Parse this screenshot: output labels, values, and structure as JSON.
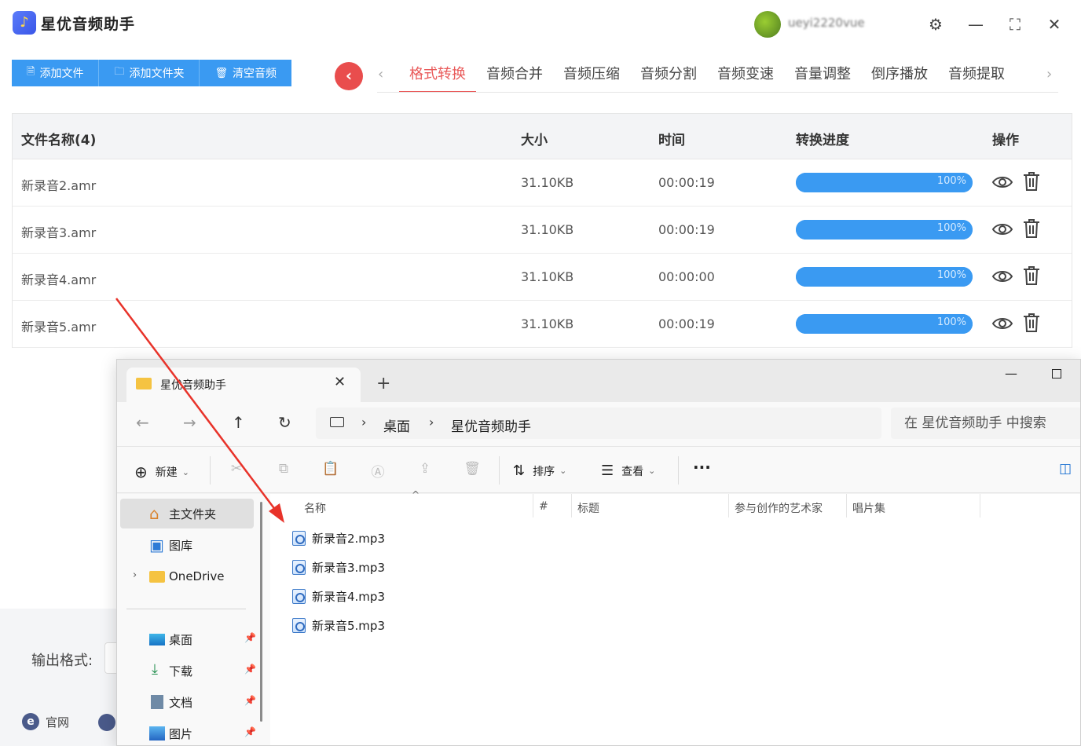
{
  "app": {
    "title": "星优音频助手",
    "logo_glyph": "♪",
    "username": "ueyi2220vue",
    "window_controls": {
      "settings": "⚙",
      "minimize": "—",
      "maximize": "⛶",
      "close": "✕"
    }
  },
  "toolbar": {
    "add_file": "添加文件",
    "add_folder": "添加文件夹",
    "clear": "清空音频",
    "add_file_icon": "document-icon",
    "add_folder_icon": "folder-icon",
    "clear_icon": "trash-icon"
  },
  "tabs": {
    "items": [
      "格式转换",
      "音频合并",
      "音频压缩",
      "音频分割",
      "音频变速",
      "音量调整",
      "倒序播放",
      "音频提取"
    ],
    "active_index": 0,
    "prev_arrow": "‹",
    "next_arrow": "›",
    "back_glyph": "‹"
  },
  "table": {
    "headers": {
      "name": "文件名称(4)",
      "size": "大小",
      "time": "时间",
      "progress": "转换进度",
      "action": "操作"
    },
    "rows": [
      {
        "name": "新录音2.amr",
        "size": "31.10KB",
        "time": "00:00:19",
        "progress": 100,
        "progress_label": "100%"
      },
      {
        "name": "新录音3.amr",
        "size": "31.10KB",
        "time": "00:00:19",
        "progress": 100,
        "progress_label": "100%"
      },
      {
        "name": "新录音4.amr",
        "size": "31.10KB",
        "time": "00:00:00",
        "progress": 100,
        "progress_label": "100%"
      },
      {
        "name": "新录音5.amr",
        "size": "31.10KB",
        "time": "00:00:19",
        "progress": 100,
        "progress_label": "100%"
      }
    ]
  },
  "footer": {
    "output_format_label": "输出格式:",
    "site_label": "官网",
    "site_glyph": "e"
  },
  "explorer": {
    "tab_title": "星优音频助手",
    "tab_close": "✕",
    "new_tab": "+",
    "min": "—",
    "breadcrumb": [
      "桌面",
      "星优音频助手"
    ],
    "breadcrumb_sep": "›",
    "search_placeholder": "在 星优音频助手 中搜索",
    "nav": {
      "back": "←",
      "forward": "→",
      "up": "↑",
      "refresh": "↻"
    },
    "toolbar": {
      "new_label": "新建",
      "sort_label": "排序",
      "view_label": "查看",
      "more": "···",
      "new_glyph": "⊕",
      "sort_glyph": "⇅",
      "view_glyph": "☰",
      "caret": "⌄"
    },
    "sidebar": {
      "items": [
        {
          "label": "主文件夹",
          "icon": "home-icon",
          "glyph": "⌂"
        },
        {
          "label": "图库",
          "icon": "gallery-icon",
          "glyph": "▣"
        },
        {
          "label": "OneDrive",
          "icon": "folder-icon",
          "glyph": ""
        }
      ],
      "pinned": [
        {
          "label": "桌面",
          "icon": "desktop-icon"
        },
        {
          "label": "下载",
          "icon": "download-icon"
        },
        {
          "label": "文档",
          "icon": "documents-icon"
        },
        {
          "label": "图片",
          "icon": "pictures-icon"
        }
      ],
      "expand_glyph": "›",
      "pin_glyph": "📌"
    },
    "columns": {
      "name": "名称",
      "number": "#",
      "title": "标题",
      "artist": "参与创作的艺术家",
      "album": "唱片集"
    },
    "sort_caret": "^",
    "files": [
      "新录音2.mp3",
      "新录音3.mp3",
      "新录音4.mp3",
      "新录音5.mp3"
    ]
  },
  "colors": {
    "primary": "#3a9af2",
    "accent_red": "#e95a5a",
    "arrow_red": "#e8332a"
  }
}
